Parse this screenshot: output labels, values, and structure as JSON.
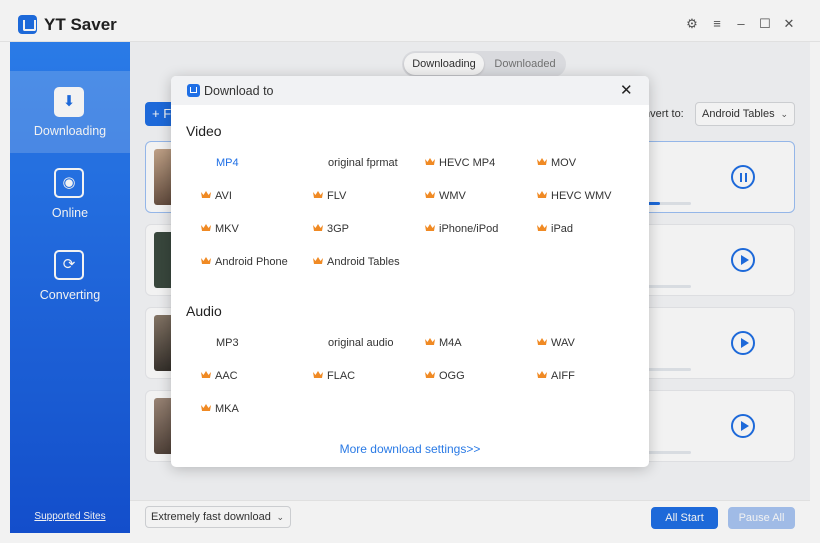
{
  "app": {
    "title": "YT Saver"
  },
  "window_controls": [
    "gear-icon",
    "menu-icon",
    "minimize-icon",
    "maximize-icon",
    "close-icon"
  ],
  "sidebar": {
    "items": [
      {
        "label": "Downloading",
        "icon": "download-icon",
        "active": true
      },
      {
        "label": "Online",
        "icon": "globe-icon",
        "active": false
      },
      {
        "label": "Converting",
        "icon": "refresh-icon",
        "active": false
      }
    ],
    "supported_sites": "Supported Sites"
  },
  "tabs": {
    "downloading": "Downloading",
    "downloaded": "Downloaded"
  },
  "toolbar": {
    "paste_label": "+ F",
    "convert_label": "nvert to:",
    "convert_value": "Android Tables"
  },
  "rows": [
    {
      "state": "downloading",
      "progress": 0.3
    },
    {
      "state": "paused",
      "progress": 0.0
    },
    {
      "state": "paused",
      "progress": 0.0
    },
    {
      "state": "paused",
      "progress": 0.0
    }
  ],
  "bottom": {
    "speed_mode": "Extremely fast download",
    "all_start": "All Start",
    "pause_all": "Pause All"
  },
  "modal": {
    "title": "Download to",
    "video_heading": "Video",
    "video_options": [
      {
        "label": "MP4",
        "premium": false,
        "selected": true
      },
      {
        "label": "original fprmat",
        "premium": false,
        "selected": false
      },
      {
        "label": "HEVC MP4",
        "premium": true,
        "selected": false
      },
      {
        "label": "MOV",
        "premium": true,
        "selected": false
      },
      {
        "label": "AVI",
        "premium": true,
        "selected": false
      },
      {
        "label": "FLV",
        "premium": true,
        "selected": false
      },
      {
        "label": "WMV",
        "premium": true,
        "selected": false
      },
      {
        "label": "HEVC WMV",
        "premium": true,
        "selected": false
      },
      {
        "label": "MKV",
        "premium": true,
        "selected": false
      },
      {
        "label": "3GP",
        "premium": true,
        "selected": false
      },
      {
        "label": "iPhone/iPod",
        "premium": true,
        "selected": false
      },
      {
        "label": "iPad",
        "premium": true,
        "selected": false
      },
      {
        "label": "Android Phone",
        "premium": true,
        "selected": false
      },
      {
        "label": "Android Tables",
        "premium": true,
        "selected": false
      }
    ],
    "audio_heading": "Audio",
    "audio_options": [
      {
        "label": "MP3",
        "premium": false,
        "selected": false
      },
      {
        "label": "original audio",
        "premium": false,
        "selected": false
      },
      {
        "label": "M4A",
        "premium": true,
        "selected": false
      },
      {
        "label": "WAV",
        "premium": true,
        "selected": false
      },
      {
        "label": "AAC",
        "premium": true,
        "selected": false
      },
      {
        "label": "FLAC",
        "premium": true,
        "selected": false
      },
      {
        "label": "OGG",
        "premium": true,
        "selected": false
      },
      {
        "label": "AIFF",
        "premium": true,
        "selected": false
      },
      {
        "label": "MKA",
        "premium": true,
        "selected": false
      }
    ],
    "more_settings": "More download settings>>"
  },
  "colors": {
    "accent": "#1f6fe5",
    "premium": "#f08a24",
    "sidebar_top": "#2d82f4",
    "sidebar_bottom": "#1553d6"
  }
}
